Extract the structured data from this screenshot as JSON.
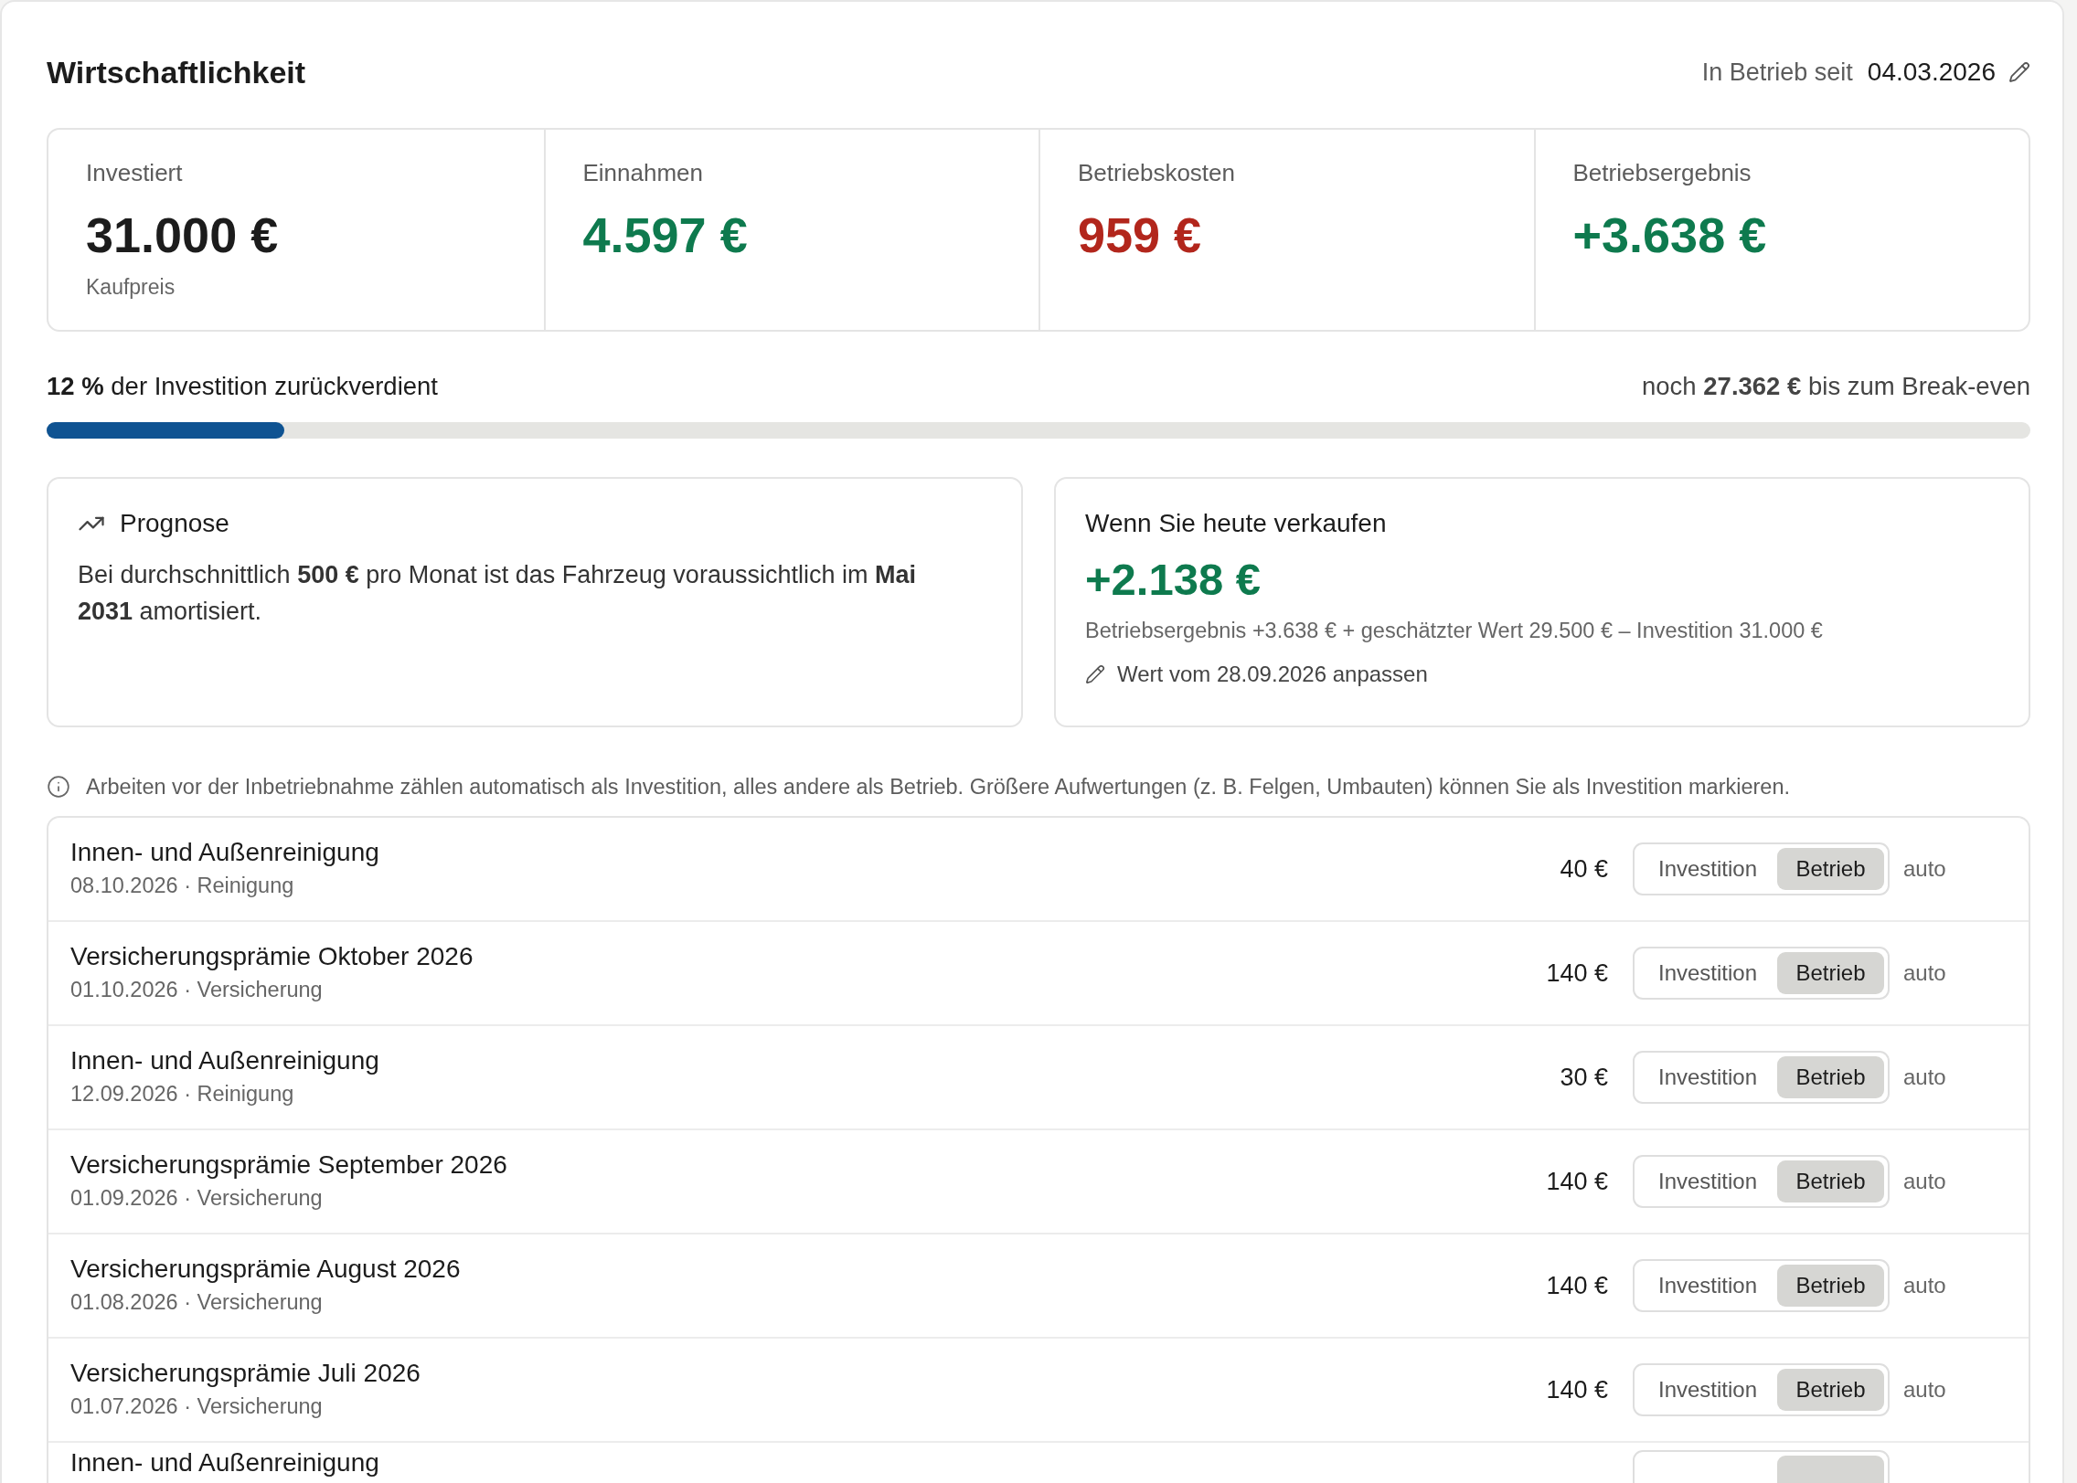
{
  "header": {
    "title": "Wirtschaftlichkeit",
    "since_label": "In Betrieb seit",
    "since_date": "04.03.2026"
  },
  "stats": [
    {
      "label": "Investiert",
      "value": "31.000 €",
      "color": "#1c1c1c",
      "note": "Kaufpreis"
    },
    {
      "label": "Einnahmen",
      "value": "4.597 €",
      "color": "#0e7a4e"
    },
    {
      "label": "Betriebskosten",
      "value": "959 €",
      "color": "#b2261c"
    },
    {
      "label": "Betriebsergebnis",
      "value": "+3.638 €",
      "color": "#0e7a4e"
    }
  ],
  "progress": {
    "label": "**12 %** der Investition zurückverdient",
    "remaining": "noch **27.362 €** bis zum Break-even",
    "level": 0.12
  },
  "forecast": {
    "title": "Prognose",
    "text": "Bei durchschnittlich **500 €** pro Monat ist das Fahrzeug voraussichtlich im **Mai 2031** amortisiert."
  },
  "sale": {
    "title": "Wenn Sie heute verkaufen",
    "value": "+2.138 €",
    "breakdown": "Betriebsergebnis +3.638 € + geschätzter Wert 29.500 € – Investition 31.000 €",
    "action": "Wert vom 28.09.2026 anpassen"
  },
  "info": "Arbeiten vor der Inbetriebnahme zählen automatisch als Investition, alles andere als Betrieb. Größere Aufwertungen (z. B. Felgen, Umbauten) können Sie als Investition markieren.",
  "entries": [
    {
      "title": "Innen- und Außenreinigung",
      "meta": "08.10.2026 · Reinigung",
      "amount": "40 €",
      "options": [
        {
          "label": "Investition",
          "selected": false
        },
        {
          "label": "Betrieb",
          "selected": true
        }
      ],
      "note": "auto"
    },
    {
      "title": "Versicherungsprämie Oktober 2026",
      "meta": "01.10.2026 · Versicherung",
      "amount": "140 €",
      "options": [
        {
          "label": "Investition",
          "selected": false
        },
        {
          "label": "Betrieb",
          "selected": true
        }
      ],
      "note": "auto"
    },
    {
      "title": "Innen- und Außenreinigung",
      "meta": "12.09.2026 · Reinigung",
      "amount": "30 €",
      "options": [
        {
          "label": "Investition",
          "selected": false
        },
        {
          "label": "Betrieb",
          "selected": true
        }
      ],
      "note": "auto"
    },
    {
      "title": "Versicherungsprämie September 2026",
      "meta": "01.09.2026 · Versicherung",
      "amount": "140 €",
      "options": [
        {
          "label": "Investition",
          "selected": false
        },
        {
          "label": "Betrieb",
          "selected": true
        }
      ],
      "note": "auto"
    },
    {
      "title": "Versicherungsprämie August 2026",
      "meta": "01.08.2026 · Versicherung",
      "amount": "140 €",
      "options": [
        {
          "label": "Investition",
          "selected": false
        },
        {
          "label": "Betrieb",
          "selected": true
        }
      ],
      "note": "auto"
    },
    {
      "title": "Versicherungsprämie Juli 2026",
      "meta": "01.07.2026 · Versicherung",
      "amount": "140 €",
      "options": [
        {
          "label": "Investition",
          "selected": false
        },
        {
          "label": "Betrieb",
          "selected": true
        }
      ],
      "note": "auto"
    },
    {
      "title": "Innen- und Außenreinigung",
      "options": [
        {
          "selected": false
        },
        {
          "selected": true
        }
      ]
    }
  ]
}
